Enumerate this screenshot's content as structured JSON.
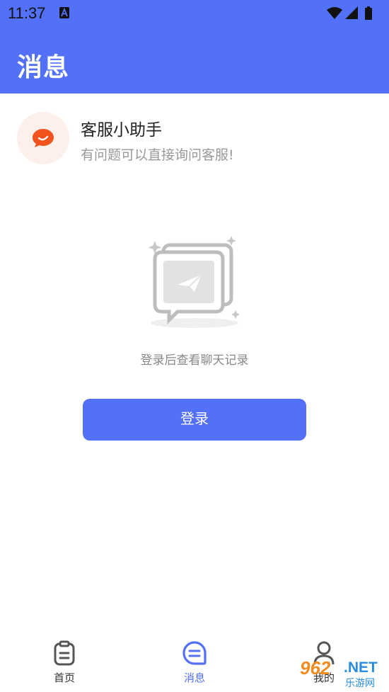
{
  "status_bar": {
    "time": "11:37",
    "icons": [
      "app-a-icon",
      "wifi-icon",
      "signal-icon",
      "battery-icon"
    ]
  },
  "header": {
    "title": "消息"
  },
  "service": {
    "name": "客服小助手",
    "description": "有问题可以直接询问客服!",
    "icon": "chat-bubble-icon"
  },
  "empty_state": {
    "icon": "message-plane-icon",
    "text": "登录后查看聊天记录"
  },
  "login_button": {
    "label": "登录"
  },
  "bottom_nav": [
    {
      "label": "首页",
      "icon": "clipboard-icon",
      "active": false
    },
    {
      "label": "消息",
      "icon": "message-icon",
      "active": true
    },
    {
      "label": "我的",
      "icon": "person-icon",
      "active": false
    }
  ],
  "watermark": {
    "number": "962",
    "domain": ".NET",
    "text": "乐游网"
  },
  "colors": {
    "primary": "#5371f8",
    "accent_orange": "#f0531e",
    "text_gray": "#999999"
  }
}
